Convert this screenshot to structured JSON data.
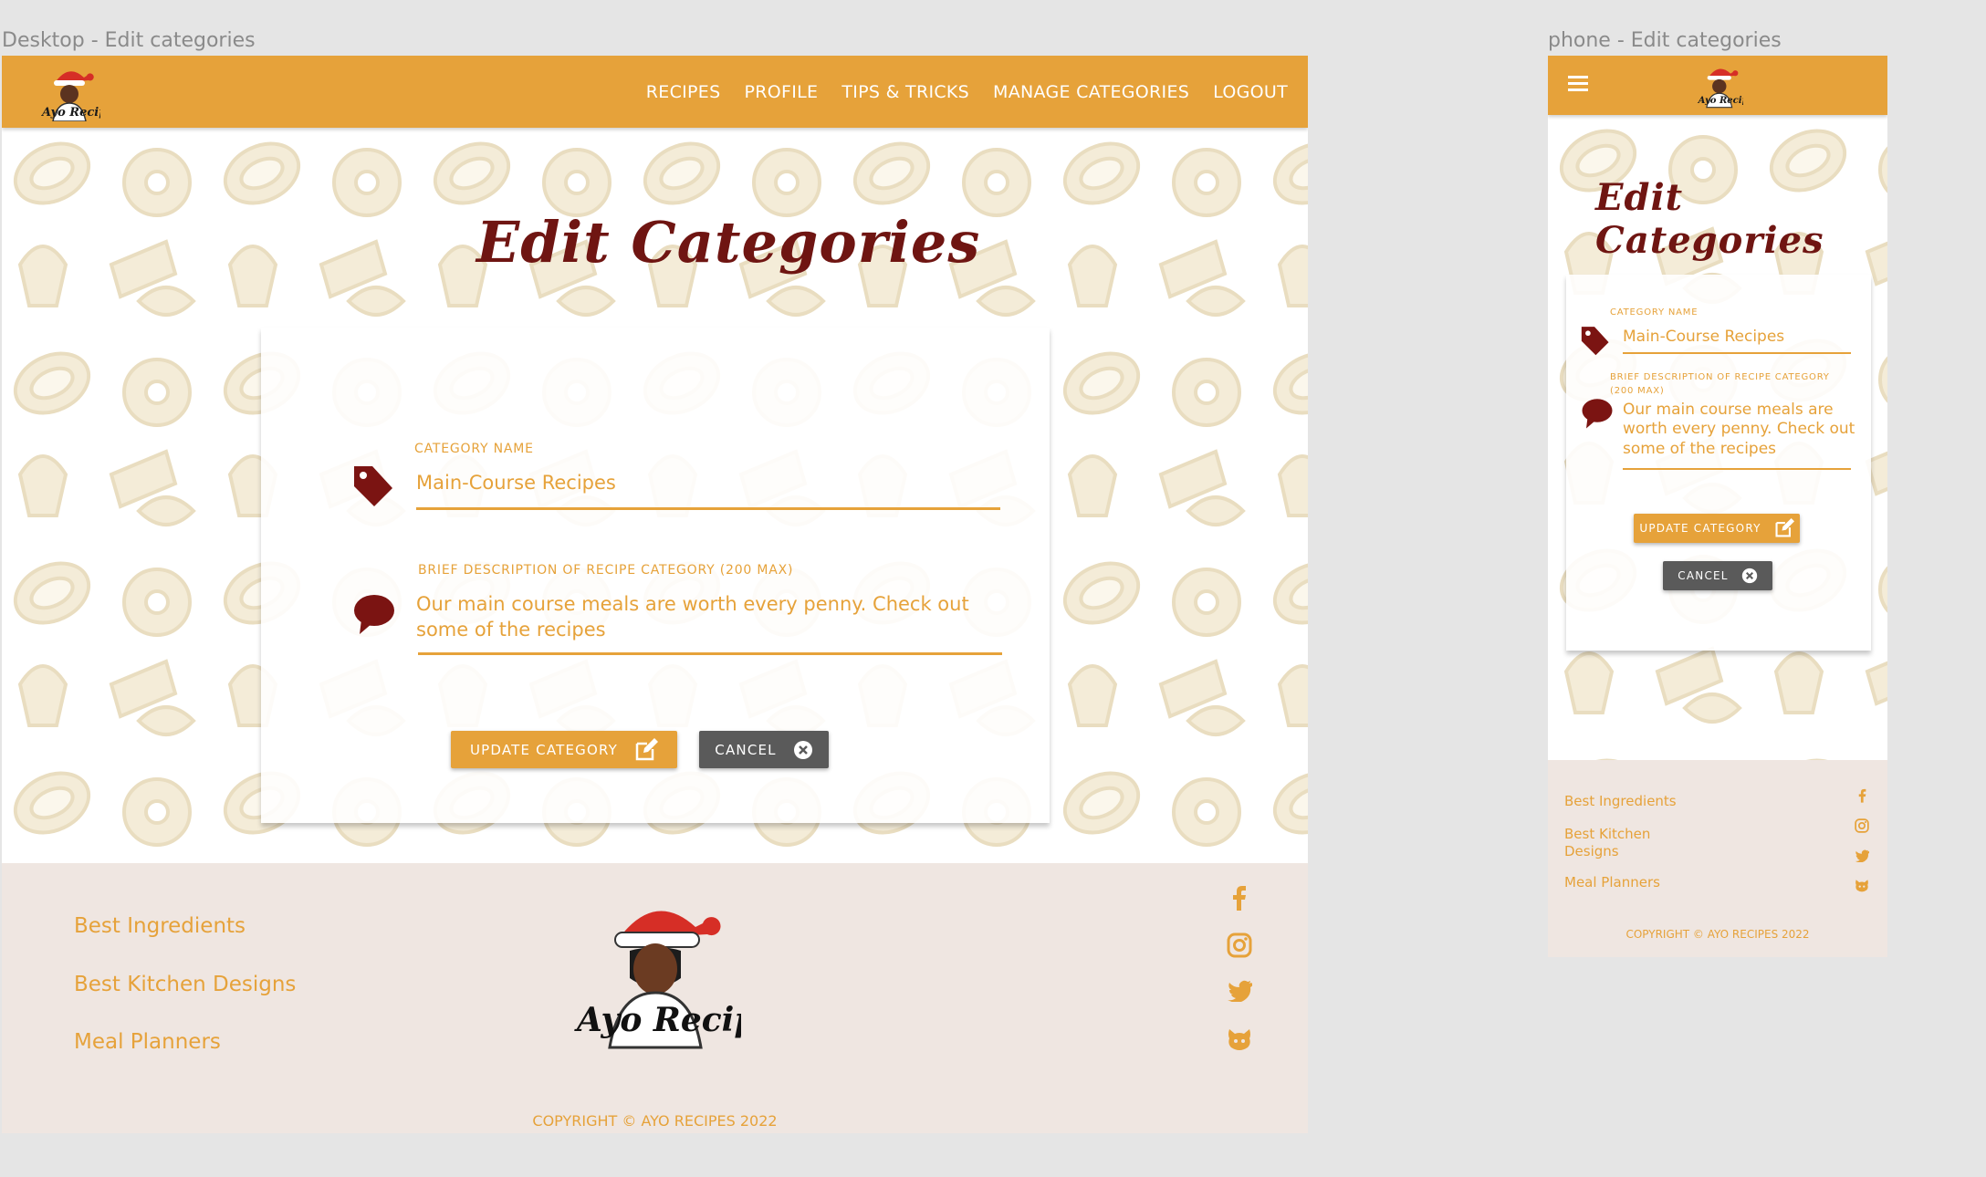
{
  "desktop": {
    "frame_label": "Desktop - Edit categories",
    "nav": [
      "RECIPES",
      "PROFILE",
      "TIPS & TRICKS",
      "MANAGE CATEGORIES",
      "LOGOUT"
    ],
    "logo_text": "Ayo Recipes",
    "title": "Edit Categories",
    "category_label": "CATEGORY NAME",
    "category_value": "Main-Course Recipes",
    "description_label": "BRIEF DESCRIPTION OF RECIPE CATEGORY (200 MAX)",
    "description_value": "Our main course meals are worth every penny. Check out some of the recipes",
    "update_button": "UPDATE CATEGORY",
    "cancel_button": "CANCEL",
    "footer_links": [
      "Best Ingredients",
      "Best Kitchen Designs",
      "Meal Planners"
    ],
    "copyright": "COPYRIGHT © AYO RECIPES 2022"
  },
  "phone": {
    "frame_label": "phone - Edit categories",
    "logo_text": "Ayo Recipes",
    "title": "Edit Categories",
    "category_label": "CATEGORY NAME",
    "category_value": "Main-Course Recipes",
    "description_label": "BRIEF DESCRIPTION OF RECIPE CATEGORY (200 MAX)",
    "description_value": "Our main course meals are worth every penny. Check out some of the recipes",
    "update_button": "UPDATE CATEGORY",
    "cancel_button": "CANCEL",
    "footer_links": [
      "Best Ingredients",
      "Best Kitchen Designs",
      "Meal Planners"
    ],
    "copyright": "COPYRIGHT © AYO RECIPES 2022"
  },
  "icons": {
    "category": "tag-icon",
    "description": "speech-bubble-icon",
    "update": "edit-icon",
    "cancel": "close-circle-icon",
    "menu": "hamburger-menu-icon",
    "social": [
      "facebook-icon",
      "instagram-icon",
      "twitter-icon",
      "github-icon"
    ]
  },
  "colors": {
    "accent": "#e6a23a",
    "title": "#6f1512",
    "icon_dark_red": "#7b1412",
    "cancel": "#5a5a5a",
    "footer_bg": "#efe6e1",
    "pattern": "#efe3c6"
  }
}
